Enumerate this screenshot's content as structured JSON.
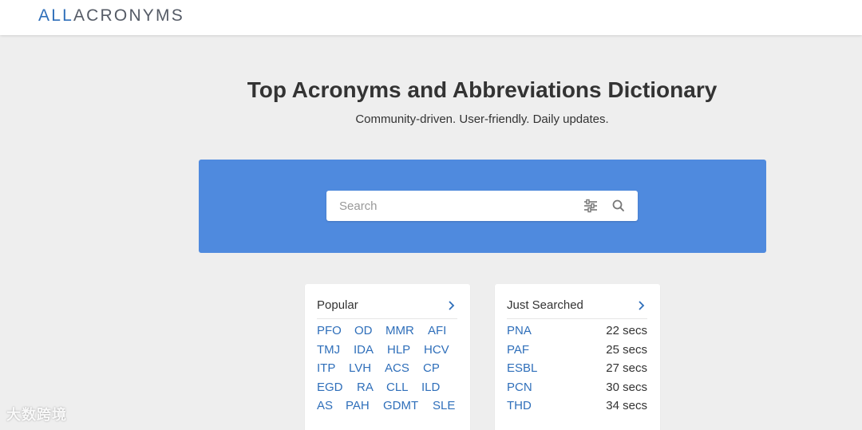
{
  "header": {
    "logo_prefix": "ALL",
    "logo_main": "ACRONYMS"
  },
  "hero": {
    "title": "Top Acronyms and Abbreviations Dictionary",
    "subtitle": "Community-driven. User-friendly. Daily updates."
  },
  "search": {
    "placeholder": "Search",
    "value": "",
    "filter_icon": "sliders-icon",
    "search_icon": "magnifier-icon"
  },
  "popular": {
    "title": "Popular",
    "rows": [
      [
        "PFO",
        "OD",
        "MMR",
        "AFI"
      ],
      [
        "TMJ",
        "IDA",
        "HLP",
        "HCV"
      ],
      [
        "ITP",
        "LVH",
        "ACS",
        "CP"
      ],
      [
        "EGD",
        "RA",
        "CLL",
        "ILD"
      ],
      [
        "AS",
        "PAH",
        "GDMT",
        "SLE"
      ]
    ]
  },
  "recent": {
    "title": "Just Searched",
    "items": [
      {
        "acronym": "PNA",
        "time": "22 secs"
      },
      {
        "acronym": "PAF",
        "time": "25 secs"
      },
      {
        "acronym": "ESBL",
        "time": "27 secs"
      },
      {
        "acronym": "PCN",
        "time": "30 secs"
      },
      {
        "acronym": "THD",
        "time": "34 secs"
      }
    ]
  },
  "watermark": "大数跨境",
  "colors": {
    "accent": "#2f6fba",
    "search_panel": "#4f8ade",
    "background": "#eeeeee"
  }
}
